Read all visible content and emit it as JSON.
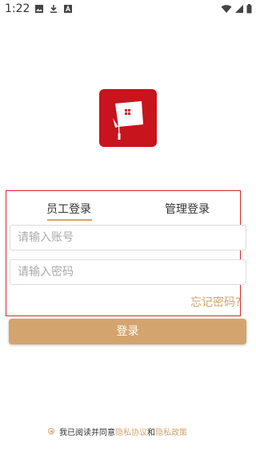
{
  "status_bar": {
    "time": "1:22",
    "icons": [
      "image-icon",
      "download-icon",
      "text-icon",
      "wifi-icon",
      "signal-icon",
      "battery-icon"
    ]
  },
  "logo": {
    "icon": "graduation-cap-icon",
    "background_color": "#c8141c"
  },
  "tabs": [
    {
      "label": "员工登录",
      "selected": true
    },
    {
      "label": "管理登录",
      "selected": false
    }
  ],
  "form": {
    "account_placeholder": "请输入账号",
    "account_value": "",
    "password_placeholder": "请输入密码",
    "password_value": "",
    "forgot_password": "忘记密码?"
  },
  "login_button": "登录",
  "agreement": {
    "prefix": "我已阅读并同意",
    "privacy_agreement": "隐私协议",
    "and": "和",
    "privacy_policy": "隐私政策",
    "checked": true
  },
  "colors": {
    "accent": "#d4a46e",
    "brand_red": "#c8141c",
    "highlight_border": "#d9252b"
  }
}
